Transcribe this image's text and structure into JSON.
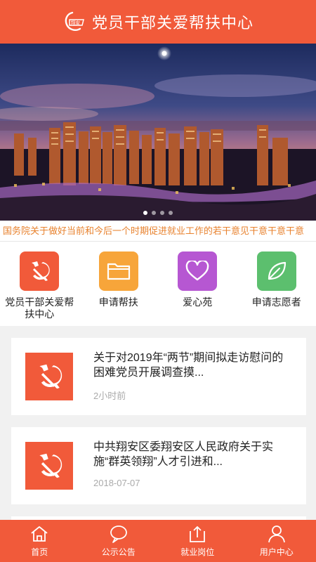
{
  "header": {
    "title": "党员干部关爱帮扶中心"
  },
  "banner": {
    "slide_count": 4,
    "active_slide": 0
  },
  "notice": {
    "text": "国务院关于做好当前和今后一个时期促进就业工作的若干意见干意干意干意"
  },
  "quick_links": [
    {
      "label": "党员干部关爱帮扶中心",
      "icon": "party-emblem-icon",
      "color": "#f15a3a"
    },
    {
      "label": "申请帮扶",
      "icon": "folder-icon",
      "color": "#f7a53a"
    },
    {
      "label": "爱心苑",
      "icon": "heart-icon",
      "color": "#b657d2"
    },
    {
      "label": "申请志愿者",
      "icon": "leaf-icon",
      "color": "#5cbf6e"
    }
  ],
  "news": [
    {
      "title": "关于对2019年“两节”期间拟走访慰问的困难党员开展调查摸...",
      "time": "2小时前"
    },
    {
      "title": "中共翔安区委翔安区人民政府关于实施“群英领翔”人才引进和...",
      "time": "2018-07-07"
    }
  ],
  "tabbar": [
    {
      "label": "首页",
      "icon": "home-icon"
    },
    {
      "label": "公示公告",
      "icon": "chat-bubble-icon"
    },
    {
      "label": "就业岗位",
      "icon": "upload-icon"
    },
    {
      "label": "用户中心",
      "icon": "user-icon"
    }
  ],
  "colors": {
    "primary": "#f15a3a",
    "notice": "#e8822e"
  }
}
